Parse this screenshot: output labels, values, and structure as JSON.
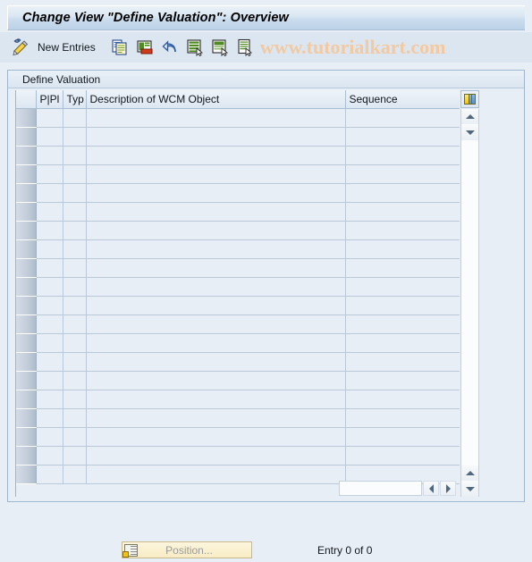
{
  "window": {
    "title": "Change View \"Define Valuation\": Overview"
  },
  "toolbar": {
    "new_entries_label": "New Entries",
    "watermark": "www.tutorialkart.com",
    "icons": [
      {
        "name": "edit-pencil-icon"
      },
      {
        "name": "copy-icon"
      },
      {
        "name": "delete-icon"
      },
      {
        "name": "undo-icon"
      },
      {
        "name": "select-all-icon"
      },
      {
        "name": "deselect-all-icon"
      },
      {
        "name": "details-icon"
      }
    ]
  },
  "panel": {
    "group_title": "Define Valuation"
  },
  "table": {
    "columns": [
      {
        "key": "select",
        "label": ""
      },
      {
        "key": "ppl",
        "label": "P|Pl"
      },
      {
        "key": "typ",
        "label": "Typ"
      },
      {
        "key": "desc",
        "label": "Description of WCM Object"
      },
      {
        "key": "seq",
        "label": "Sequence"
      }
    ],
    "rows": [],
    "empty_row_count": 20,
    "column_config_icon": "table-settings-icon"
  },
  "scrollbars": {
    "vertical": {
      "up_arrow": "scroll-up-icon",
      "down_arrow": "scroll-down-icon"
    },
    "horizontal": {
      "left_arrow": "scroll-left-icon",
      "right_arrow": "scroll-right-icon"
    }
  },
  "footer": {
    "position_button_label": "Position...",
    "position_button_icon": "position-icon",
    "entry_status": "Entry 0 of 0"
  },
  "colors": {
    "background": "#e8eef5",
    "titlebar_start": "#eaf1f8",
    "titlebar_end": "#bcd2e8",
    "toolbar": "#dce6f0",
    "border": "#9fb6cd",
    "watermark": "#f2c9a0",
    "button_yellow": "#f7ecc4"
  }
}
